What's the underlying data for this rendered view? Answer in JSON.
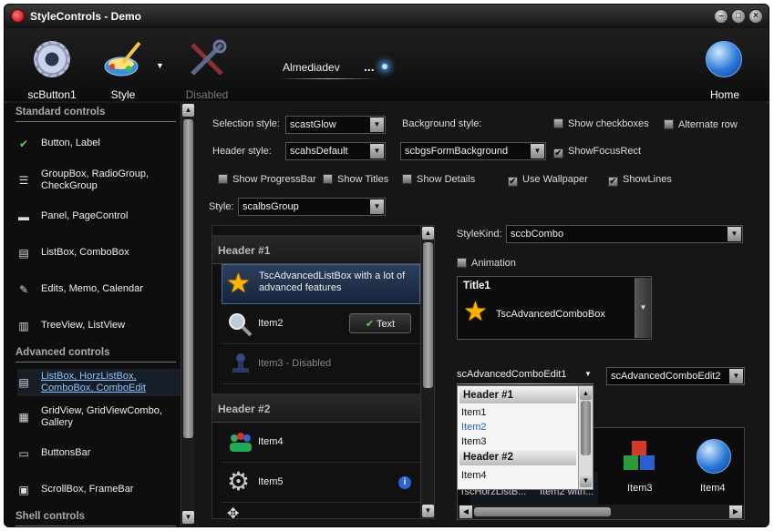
{
  "window": {
    "title": "StyleControls - Demo",
    "min": "–",
    "max": "□",
    "close": "×"
  },
  "toolbar": {
    "btn1": "scButton1",
    "style": "Style",
    "disabled": "Disabled",
    "user": "Almediadev",
    "ellipsis": "...",
    "home": "Home"
  },
  "sidebar": {
    "standard_title": "Standard controls",
    "standard": [
      {
        "label": "Button, Label"
      },
      {
        "label": "GroupBox, RadioGroup, CheckGroup"
      },
      {
        "label": "Panel, PageControl"
      },
      {
        "label": "ListBox, ComboBox"
      },
      {
        "label": "Edits, Memo, Calendar"
      },
      {
        "label": "TreeView, ListView"
      }
    ],
    "advanced_title": "Advanced controls",
    "advanced": [
      {
        "label": "ListBox, HorzListBox, ComboBox, ComboEdit"
      },
      {
        "label": "GridView, GridViewCombo, Gallery"
      },
      {
        "label": "ButtonsBar"
      },
      {
        "label": "ScrollBox, FrameBar"
      }
    ],
    "shell_title": "Shell controls"
  },
  "settings": {
    "selection_style_label": "Selection style:",
    "selection_style": "scastGlow",
    "background_style_label": "Background style:",
    "header_style_label": "Header style:",
    "header_style": "scahsDefault",
    "bg_style": "scbgsFormBackground",
    "style_label": "Style:",
    "style": "scalbsGroup",
    "checks": {
      "show_checkboxes": "Show checkboxes",
      "alternate_row": "Alternate row",
      "show_focus_rect": "ShowFocusRect",
      "show_progressbar": "Show ProgressBar",
      "show_titles": "Show Titles",
      "show_details": "Show Details",
      "use_wallpaper": "Use Wallpaper",
      "show_lines": "ShowLines"
    }
  },
  "listbox": {
    "header1": "Header #1",
    "item_adv": "TscAdvancedListBox with a lot of advanced features",
    "item2": "Item2",
    "text_button": "Text",
    "item3": "Item3 - Disabled",
    "header2": "Header #2",
    "item4": "Item4",
    "item5": "Item5"
  },
  "right": {
    "stylekind_label": "StyleKind:",
    "stylekind": "sccbCombo",
    "animation": "Animation",
    "title1": "Title1",
    "adv_combo": "TscAdvancedComboBox",
    "combo_edit1": "scAdvancedComboEdit1",
    "combo_edit2": "scAdvancedComboEdit2",
    "dropdown": {
      "header1": "Header #1",
      "i1": "Item1",
      "i2": "Item2",
      "i3": "Item3",
      "header2": "Header #2",
      "i4": "Item4"
    },
    "icons": {
      "a": "TscHorzListB...",
      "b": "Item2 with...",
      "c": "Item3",
      "d": "Item4"
    }
  }
}
